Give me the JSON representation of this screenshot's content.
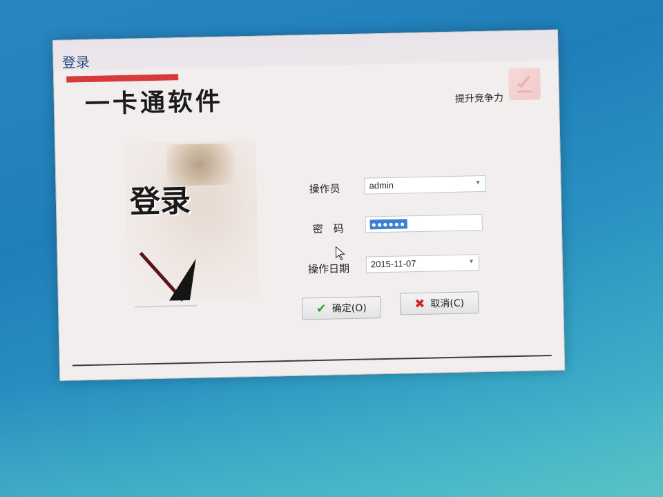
{
  "window": {
    "title": "登录",
    "app_name": "一卡通软件",
    "slogan": "提升竞争力",
    "art_title": "登录"
  },
  "form": {
    "operator": {
      "label": "操作员",
      "value": "admin"
    },
    "password": {
      "label": "密　码",
      "mask": "●●●●●●"
    },
    "date": {
      "label": "操作日期",
      "value": "2015-11-07"
    }
  },
  "buttons": {
    "ok": {
      "label": "确定(O)",
      "icon": "check-icon"
    },
    "cancel": {
      "label": "取消(C)",
      "icon": "cross-icon"
    }
  },
  "colors": {
    "accent_red": "#d73a3a",
    "title_blue": "#2a4b84",
    "ok_green": "#2aa52a",
    "cancel_red": "#d42525",
    "selection_blue": "#3d7fd1"
  }
}
